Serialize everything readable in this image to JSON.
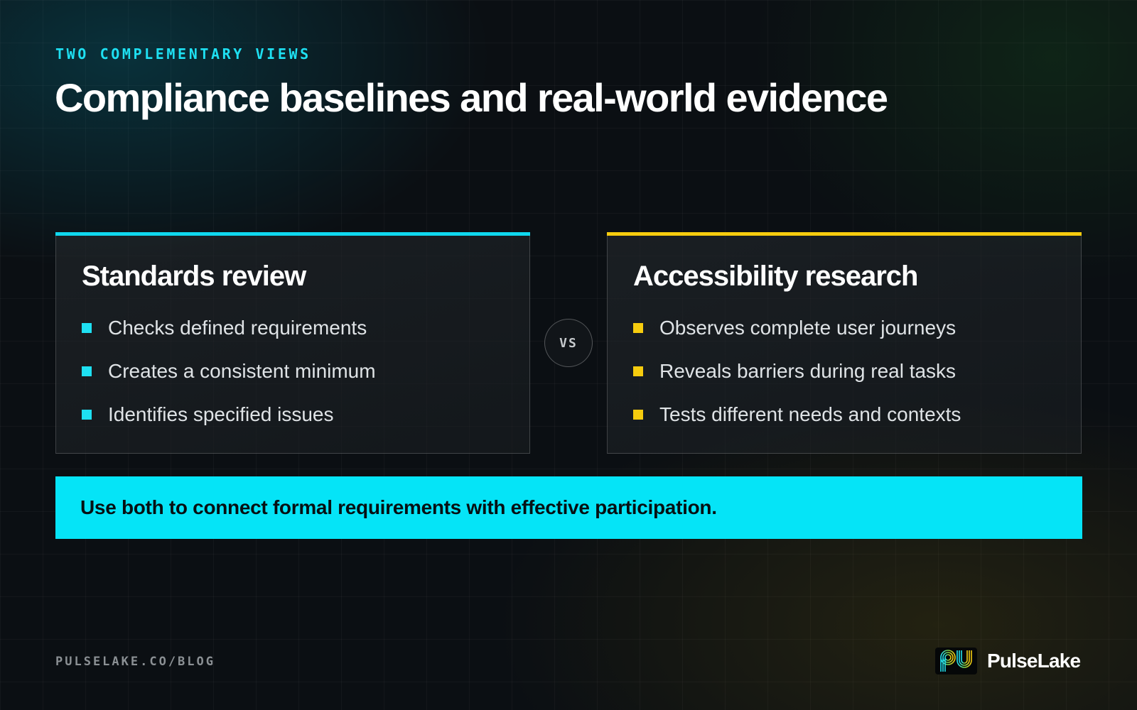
{
  "header": {
    "eyebrow": "TWO COMPLEMENTARY VIEWS",
    "title": "Compliance baselines and real-world evidence"
  },
  "comparison": {
    "left": {
      "title": "Standards review",
      "accent_color": "#0fd8ef",
      "items": [
        "Checks defined requirements",
        "Creates a consistent minimum",
        "Identifies specified issues"
      ]
    },
    "divider_label": "VS",
    "right": {
      "title": "Accessibility research",
      "accent_color": "#f6cc0e",
      "items": [
        "Observes complete user journeys",
        "Reveals barriers during real tasks",
        "Tests different needs and contexts"
      ]
    }
  },
  "callout": {
    "text": "Use both to connect formal requirements with effective participation.",
    "background_color": "#05e4f7"
  },
  "footer": {
    "url": "PULSELAKE.CO/BLOG",
    "brand_name": "PulseLake",
    "logo_icon": "pulselake-logo-icon"
  }
}
